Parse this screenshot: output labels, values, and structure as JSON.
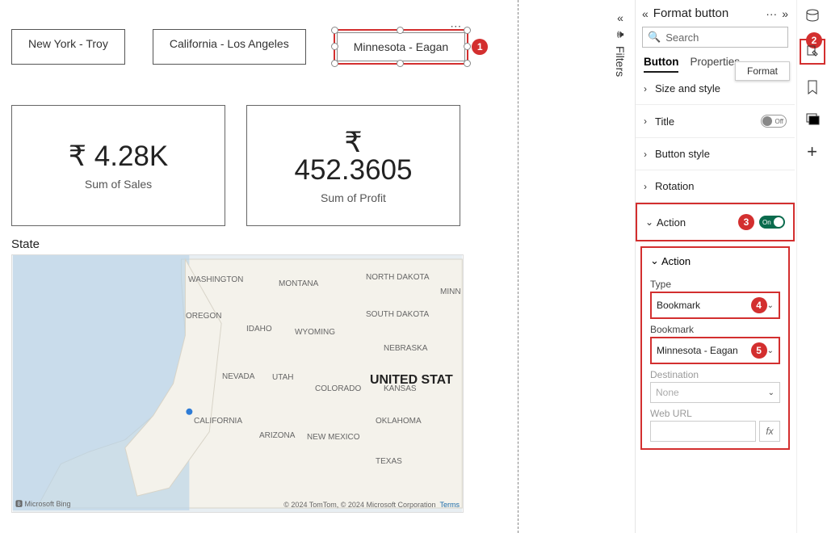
{
  "buttons": {
    "b1": "New York - Troy",
    "b2": "California - Los Angeles",
    "b3": "Minnesota - Eagan"
  },
  "badges": {
    "n1": "1",
    "n2": "2",
    "n3": "3",
    "n4": "4",
    "n5": "5"
  },
  "cards": {
    "sales": {
      "value": "₹ 4.28K",
      "label": "Sum of Sales"
    },
    "profit": {
      "value_symbol": "₹",
      "value": "452.3605",
      "label": "Sum of Profit"
    }
  },
  "map": {
    "title": "State",
    "states": [
      "WASHINGTON",
      "MONTANA",
      "NORTH DAKOTA",
      "MINN",
      "OREGON",
      "IDAHO",
      "WYOMING",
      "SOUTH DAKOTA",
      "NEBRASKA",
      "NEVADA",
      "UTAH",
      "COLORADO",
      "KANSAS",
      "CALIFORNIA",
      "ARIZONA",
      "NEW MEXICO",
      "OKLAHOMA",
      "TEXAS"
    ],
    "big_label": "UNITED STAT",
    "bing": "Microsoft Bing",
    "copyright": "© 2024 TomTom, © 2024 Microsoft Corporation",
    "terms": "Terms"
  },
  "filters": {
    "expand": "«",
    "label": "Filters"
  },
  "pane": {
    "collapse": "«",
    "title": "Format button",
    "more": "···",
    "expand": "»",
    "search_placeholder": "Search",
    "tooltip": "Format",
    "tabs": {
      "a": "Button",
      "b": "Properties"
    },
    "rows": {
      "size": "Size and style",
      "title": "Title",
      "bstyle": "Button style",
      "rotation": "Rotation",
      "action": "Action"
    },
    "toggle": {
      "off": "Off",
      "on": "On"
    },
    "action": {
      "header": "Action",
      "type_label": "Type",
      "type_value": "Bookmark",
      "bookmark_label": "Bookmark",
      "bookmark_value": "Minnesota - Eagan",
      "dest_label": "Destination",
      "dest_value": "None",
      "weburl_label": "Web URL",
      "fx": "fx"
    }
  },
  "icons": {
    "data": "data-icon",
    "format": "format-pane-icon",
    "bookmark": "bookmark-icon",
    "select": "selection-icon",
    "plus": "plus-icon"
  }
}
